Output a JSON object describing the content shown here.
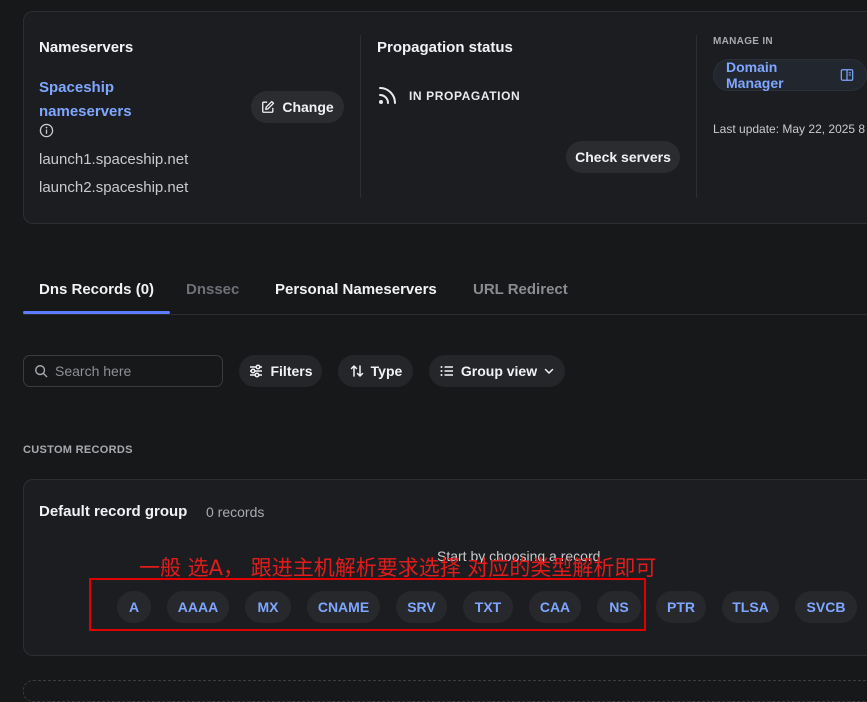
{
  "nameservers": {
    "title": "Nameservers",
    "provider_line1": "Spaceship",
    "provider_line2": "nameservers",
    "change_label": "Change",
    "ns1": "launch1.spaceship.net",
    "ns2": "launch2.spaceship.net"
  },
  "propagation": {
    "title": "Propagation status",
    "status": "IN PROPAGATION",
    "check_label": "Check servers"
  },
  "manage": {
    "label": "MANAGE IN",
    "button": "Domain Manager",
    "last_update": "Last update: May 22, 2025 8"
  },
  "tabs": [
    {
      "label": "Dns Records (0)",
      "active": true
    },
    {
      "label": "Dnssec",
      "active": false
    },
    {
      "label": "Personal Nameservers",
      "active": false
    },
    {
      "label": "URL Redirect",
      "active": false
    }
  ],
  "toolbar": {
    "search_placeholder": "Search here",
    "filters": "Filters",
    "type": "Type",
    "group_view": "Group view"
  },
  "section_label": "CUSTOM RECORDS",
  "group": {
    "title": "Default record group",
    "count": "0 records",
    "prompt": "Start by choosing a record"
  },
  "record_types": [
    "A",
    "AAAA",
    "MX",
    "CNAME",
    "SRV",
    "TXT",
    "CAA",
    "NS",
    "PTR",
    "TLSA",
    "SVCB"
  ],
  "annotation": "一般 选A， 跟进主机解析要求选择 对应的类型解析即可",
  "colors": {
    "background": "#17181a",
    "card": "#1c1d20",
    "accent_blue": "#7fa7ff",
    "tab_underline": "#5b7cff",
    "annotation_red": "#e00000"
  }
}
